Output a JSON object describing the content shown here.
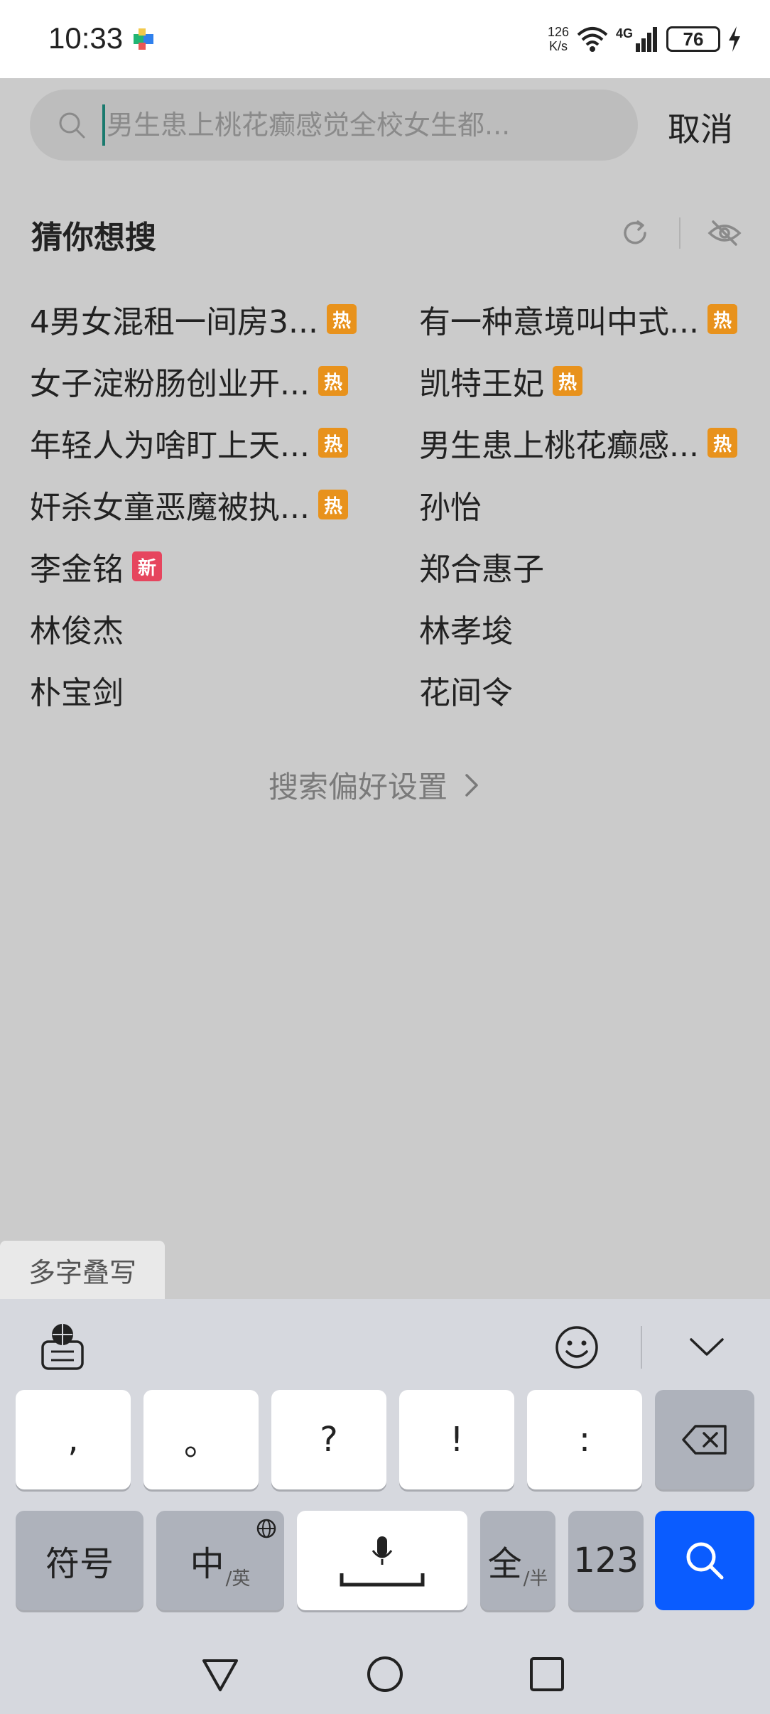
{
  "status": {
    "time": "10:33",
    "net_speed_value": "126",
    "net_speed_unit": "K/s",
    "signal_label": "4G",
    "battery": "76"
  },
  "search": {
    "placeholder": "男生患上桃花癫感觉全校女生都...",
    "cancel_label": "取消"
  },
  "section": {
    "title": "猜你想搜"
  },
  "suggestions": [
    {
      "text": "4男女混租一间房3...",
      "badge": "热"
    },
    {
      "text": "有一种意境叫中式...",
      "badge": "热"
    },
    {
      "text": "女子淀粉肠创业开...",
      "badge": "热"
    },
    {
      "text": "凯特王妃",
      "badge": "热"
    },
    {
      "text": "年轻人为啥盯上天...",
      "badge": "热"
    },
    {
      "text": "男生患上桃花癫感...",
      "badge": "热"
    },
    {
      "text": "奸杀女童恶魔被执...",
      "badge": "热"
    },
    {
      "text": "孙怡",
      "badge": ""
    },
    {
      "text": "李金铭",
      "badge": "新"
    },
    {
      "text": "郑合惠子",
      "badge": ""
    },
    {
      "text": "林俊杰",
      "badge": ""
    },
    {
      "text": "林孝埈",
      "badge": ""
    },
    {
      "text": "朴宝剑",
      "badge": ""
    },
    {
      "text": "花间令",
      "badge": ""
    }
  ],
  "preference_link": "搜索偏好设置",
  "handwriting_tab": "多字叠写",
  "keyboard": {
    "row1": [
      ",",
      "。",
      "?",
      "!",
      ":"
    ],
    "symbols": "符号",
    "lang_main": "中",
    "lang_sub": "/英",
    "full_main": "全",
    "full_sub": "/半",
    "numbers": "123"
  },
  "colors": {
    "hot_badge": "#e8921c",
    "new_badge": "#e6455e",
    "search_key": "#0a5cff"
  }
}
